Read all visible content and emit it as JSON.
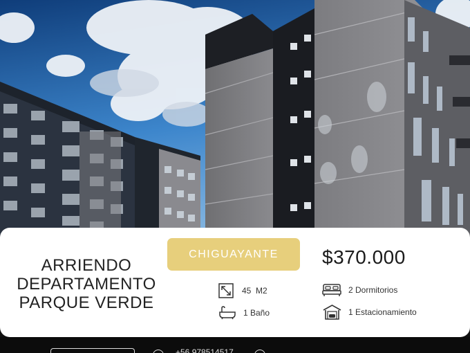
{
  "listing": {
    "title_lines": [
      "ARRIENDO",
      "DEPARTAMENTO",
      "PARQUE VERDE"
    ],
    "location": "CHIGUAYANTE",
    "price": "$370.000",
    "features": {
      "area": "45  M2",
      "bedrooms": "2 Dormitorios",
      "bathrooms": "1 Baño",
      "parking": "1 Estacionamiento"
    }
  },
  "footer": {
    "phone": "+56 978514517"
  },
  "colors": {
    "accent": "#e7cf7c",
    "sky": "#2f6fb8",
    "card": "#ffffff"
  },
  "icons": [
    "resize-arrows-icon",
    "bed-icon",
    "bathtub-icon",
    "garage-icon",
    "phone-icon",
    "instagram-icon"
  ]
}
